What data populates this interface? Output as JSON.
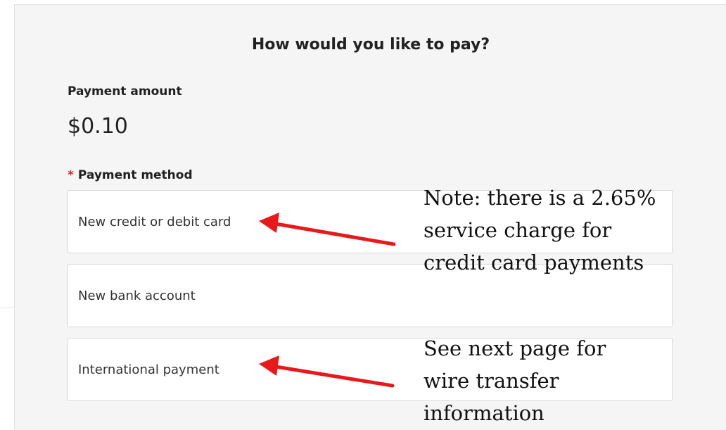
{
  "page": {
    "title": "How would you like to pay?"
  },
  "payment_amount": {
    "label": "Payment amount",
    "value": "$0.10"
  },
  "payment_method": {
    "required_marker": "*",
    "label": "Payment method",
    "options": [
      {
        "label": "New credit or debit card"
      },
      {
        "label": "New bank account"
      },
      {
        "label": "International payment"
      }
    ]
  },
  "annotations": {
    "credit_card_note": {
      "lines": [
        "Note: there is a 2.65%",
        "service charge for",
        "credit card payments"
      ]
    },
    "international_note": {
      "lines": [
        "See next page for",
        "wire transfer",
        "information"
      ]
    },
    "arrow_color": "#e8191b"
  },
  "colors": {
    "panel_background": "#f5f5f5",
    "card_background": "#ffffff",
    "required_star": "#d0312d"
  }
}
